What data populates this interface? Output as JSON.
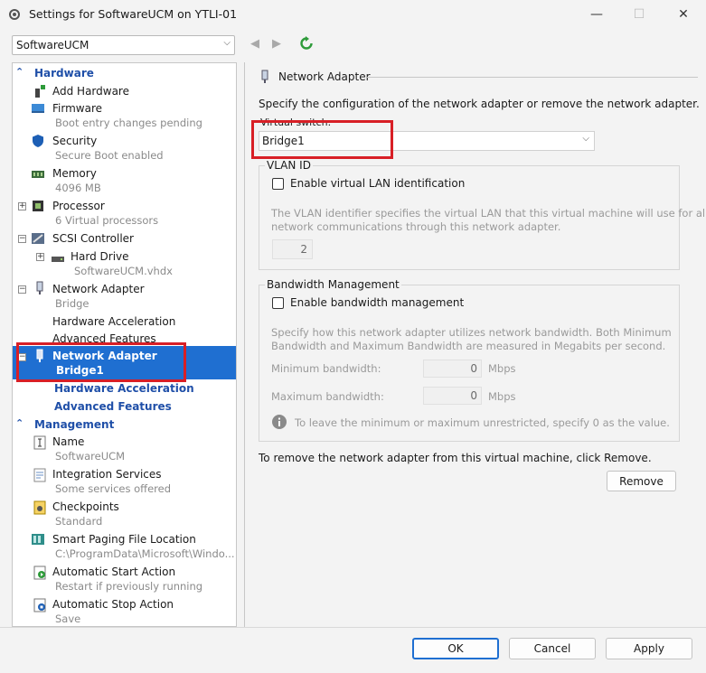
{
  "window": {
    "title": "Settings for SoftwareUCM on YTLI-01",
    "minimize_glyph": "—",
    "maximize_glyph": "☐",
    "close_glyph": "✕"
  },
  "vm_selector": {
    "value": "SoftwareUCM",
    "arrow": "⌵"
  },
  "nav": {
    "back": "◀",
    "forward": "▶"
  },
  "tree": {
    "hardware_header": "Hardware",
    "management_header": "Management",
    "items": [
      {
        "label": "Add Hardware"
      },
      {
        "label": "Firmware",
        "sub": "Boot entry changes pending"
      },
      {
        "label": "Security",
        "sub": "Secure Boot enabled"
      },
      {
        "label": "Memory",
        "sub": "4096 MB"
      },
      {
        "label": "Processor",
        "sub": "6 Virtual processors"
      },
      {
        "label": "SCSI Controller"
      },
      {
        "label": "Hard Drive",
        "sub": "SoftwareUCM.vhdx"
      },
      {
        "label": "Network Adapter",
        "sub": "Bridge"
      },
      {
        "label": "Hardware Acceleration"
      },
      {
        "label": "Advanced Features"
      },
      {
        "label": "Network Adapter",
        "sub": "Bridge1"
      },
      {
        "label": "Hardware Acceleration"
      },
      {
        "label": "Advanced Features"
      }
    ],
    "mgmt_items": [
      {
        "label": "Name",
        "sub": "SoftwareUCM"
      },
      {
        "label": "Integration Services",
        "sub": "Some services offered"
      },
      {
        "label": "Checkpoints",
        "sub": "Standard"
      },
      {
        "label": "Smart Paging File Location",
        "sub": "C:\\ProgramData\\Microsoft\\Windo..."
      },
      {
        "label": "Automatic Start Action",
        "sub": "Restart if previously running"
      },
      {
        "label": "Automatic Stop Action",
        "sub": "Save"
      }
    ]
  },
  "panel": {
    "title": "Network Adapter",
    "description": "Specify the configuration of the network adapter or remove the network adapter.",
    "virtual_switch_label": "Virtual switch:",
    "virtual_switch_value": "Bridge1",
    "vlan_group": "VLAN ID",
    "vlan_checkbox": "Enable virtual LAN identification",
    "vlan_help_1": "The VLAN identifier specifies the virtual LAN that this virtual machine will use for all",
    "vlan_help_2": "network communications through this network adapter.",
    "vlan_value": "2",
    "bw_group": "Bandwidth Management",
    "bw_checkbox": "Enable bandwidth management",
    "bw_help_1": "Specify how this network adapter utilizes network bandwidth. Both Minimum",
    "bw_help_2": "Bandwidth and Maximum Bandwidth are measured in Megabits per second.",
    "min_label": "Minimum bandwidth:",
    "min_value": "0",
    "max_label": "Maximum bandwidth:",
    "max_value": "0",
    "unit": "Mbps",
    "info_text": "To leave the minimum or maximum unrestricted, specify 0 as the value.",
    "remove_text": "To remove the network adapter from this virtual machine, click Remove.",
    "remove_button": "Remove"
  },
  "footer": {
    "ok": "OK",
    "cancel": "Cancel",
    "apply": "Apply"
  },
  "colors": {
    "selection": "#1f6fd1",
    "highlight_box": "#d81f26",
    "link_blue": "#1f4fa8"
  }
}
